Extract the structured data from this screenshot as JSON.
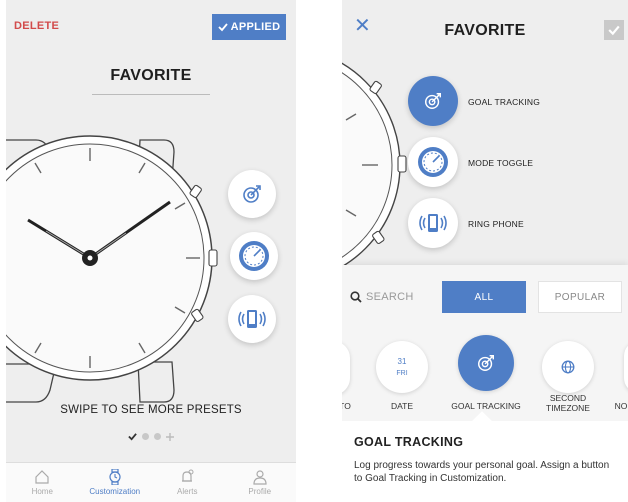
{
  "left": {
    "delete_label": "DELETE",
    "applied_label": "APPLIED",
    "title": "FAVORITE",
    "swipe_hint": "SWIPE TO SEE MORE PRESETS",
    "tabs": [
      {
        "label": "Home",
        "icon": "home-icon"
      },
      {
        "label": "Customization",
        "icon": "watch-icon"
      },
      {
        "label": "Alerts",
        "icon": "bell-icon"
      },
      {
        "label": "Profile",
        "icon": "person-icon"
      }
    ],
    "active_tab": "Customization"
  },
  "right": {
    "title": "FAVORITE",
    "complications": [
      {
        "label": "GOAL TRACKING",
        "icon": "goal-target-icon"
      },
      {
        "label": "MODE TOGGLE",
        "icon": "mode-dial-icon"
      },
      {
        "label": "RING PHONE",
        "icon": "ring-phone-icon"
      }
    ],
    "search_label": "SEARCH",
    "filters": [
      "ALL",
      "POPULAR"
    ],
    "library": [
      {
        "label": "TO",
        "icon": "partial-icon"
      },
      {
        "label": "DATE",
        "day": "31",
        "weekday": "FRI",
        "icon": "date-icon"
      },
      {
        "label": "GOAL TRACKING",
        "icon": "goal-target-icon"
      },
      {
        "label_line1": "SECOND",
        "label_line2": "TIMEZONE",
        "icon": "globe-icon"
      },
      {
        "label": "NO",
        "icon": "partial-icon"
      }
    ],
    "detail": {
      "title": "GOAL TRACKING",
      "text": "Log progress towards your personal goal. Assign a button to Goal Tracking in Customization."
    }
  },
  "colors": {
    "accent": "#4f7ec6",
    "delete": "#d24b4b",
    "background": "#eeeeee"
  }
}
